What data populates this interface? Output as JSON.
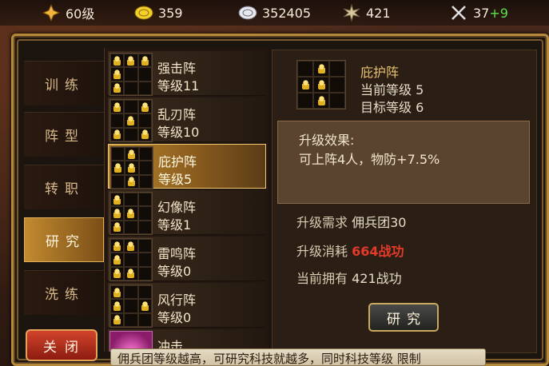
{
  "resources": {
    "level": "60级",
    "gold": "359",
    "silver": "352405",
    "merit": "421",
    "stamina": "37",
    "stamina_bonus": "+9"
  },
  "tabs": [
    {
      "label": "训练"
    },
    {
      "label": "阵型"
    },
    {
      "label": "转职"
    },
    {
      "label": "研究",
      "active": true
    },
    {
      "label": "洗练"
    }
  ],
  "close_button": "关闭",
  "formations": [
    {
      "name": "强击阵",
      "level": "等级11"
    },
    {
      "name": "乱刃阵",
      "level": "等级10"
    },
    {
      "name": "庇护阵",
      "level": "等级5",
      "active": true
    },
    {
      "name": "幻像阵",
      "level": "等级1"
    },
    {
      "name": "雷鸣阵",
      "level": "等级0"
    },
    {
      "name": "风行阵",
      "level": "等级0"
    },
    {
      "name": "冲击",
      "level": ""
    }
  ],
  "detail": {
    "name": "庇护阵",
    "current_level": "当前等级 5",
    "target_level": "目标等级 6",
    "effect_title": "升级效果:",
    "effect_value": "可上阵4人，物防+7.5%",
    "req_label": "升级需求",
    "req_value": "佣兵团30",
    "cost_label": "升级消耗",
    "cost_value": "664战功",
    "owned_label": "当前拥有",
    "owned_value": "421战功",
    "research_button": "研究"
  },
  "tip": "佣兵团等级越高，可研究科技就越多，同时科技等级 限制"
}
